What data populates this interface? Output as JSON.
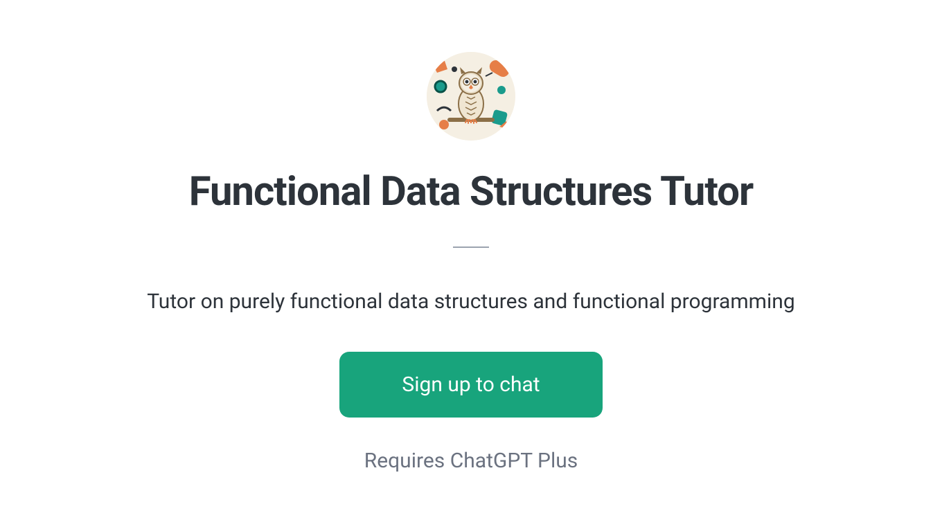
{
  "avatar": {
    "icon_name": "owl-avatar"
  },
  "title": "Functional Data Structures Tutor",
  "description": "Tutor on purely functional data structures and functional programming",
  "signup_button_label": "Sign up to chat",
  "requires_text": "Requires ChatGPT Plus",
  "colors": {
    "primary": "#18a47c",
    "text_dark": "#2d333a",
    "text_muted": "#6b7280"
  }
}
